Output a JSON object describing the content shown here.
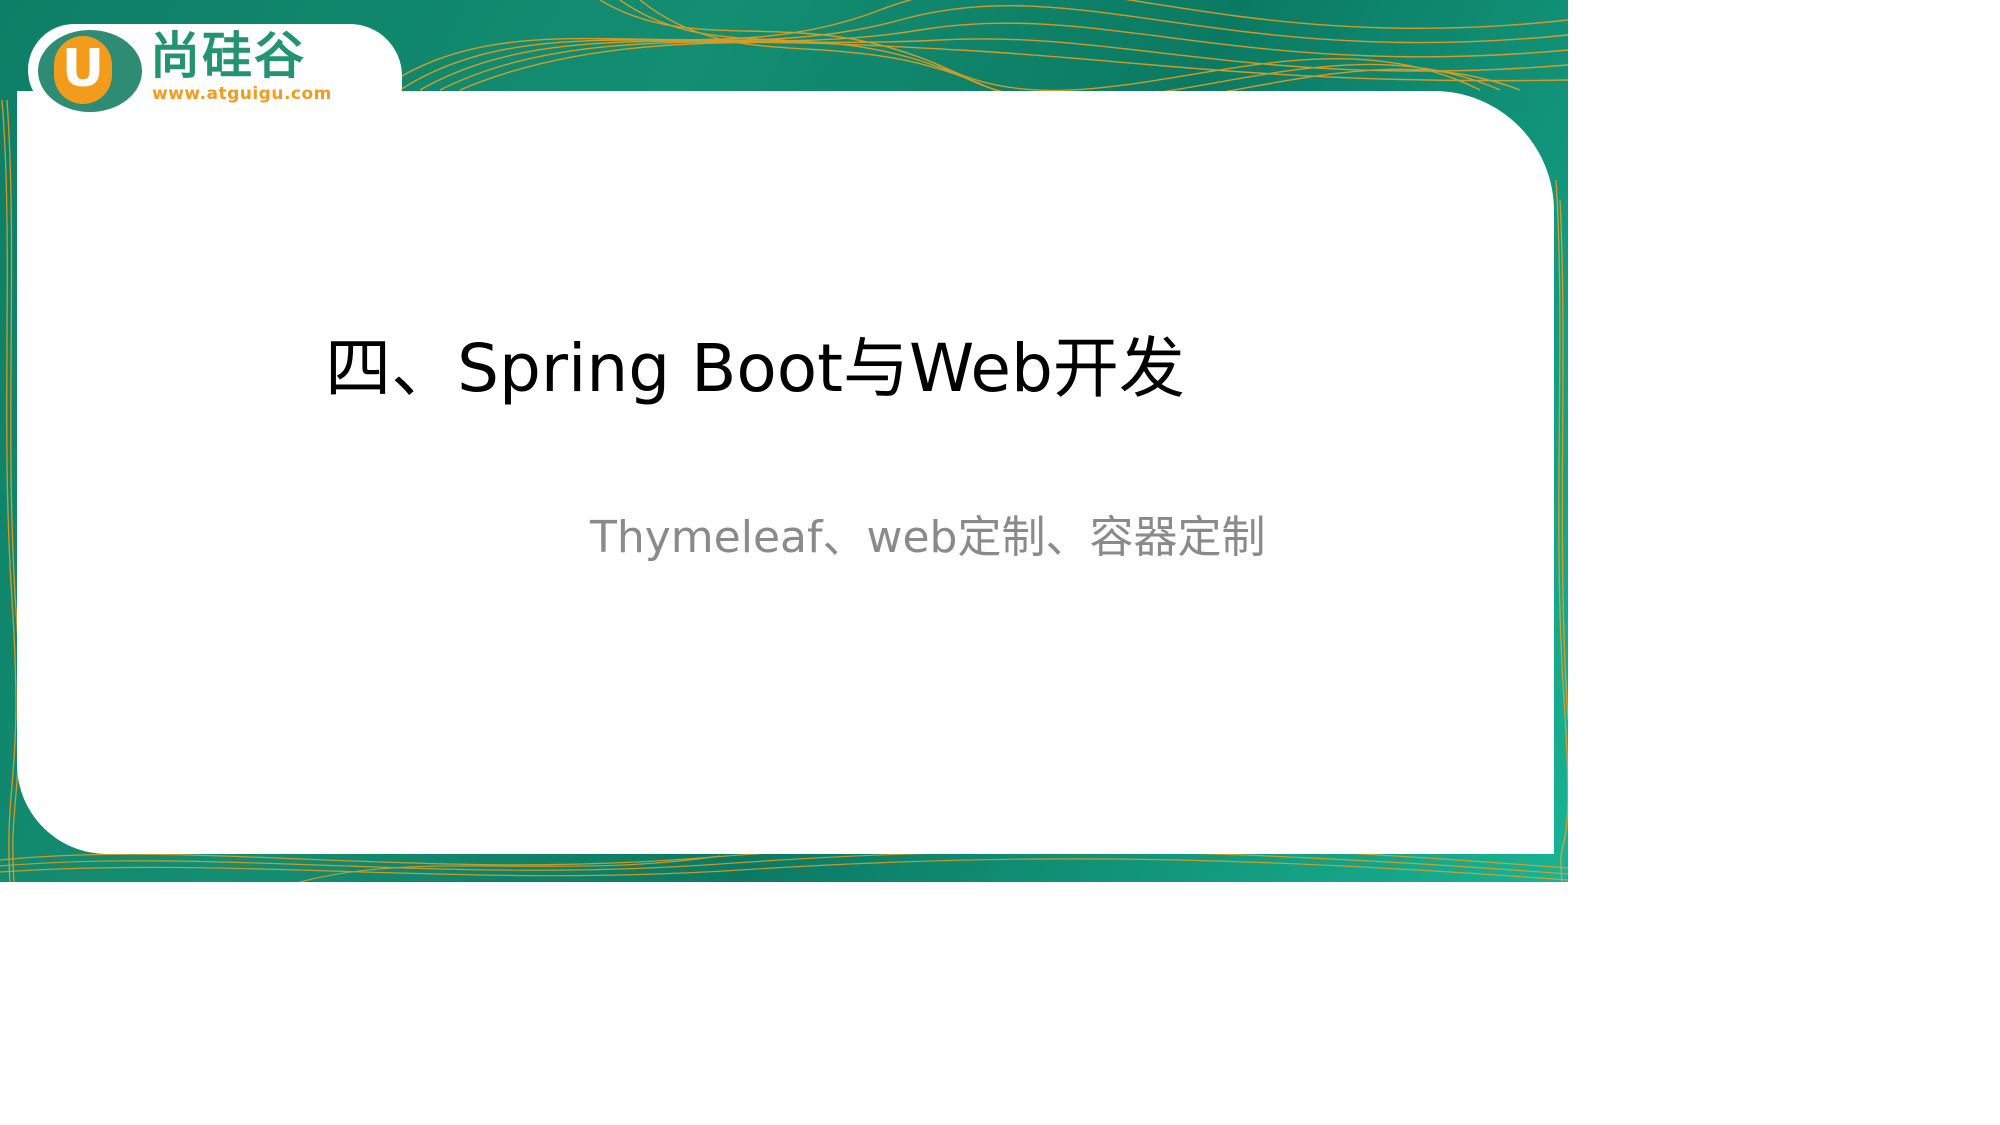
{
  "logo": {
    "badge_letter": "U",
    "name": "尚硅谷",
    "url": "www.atguigu.com"
  },
  "slide": {
    "title": "四、Spring Boot与Web开发",
    "subtitle": "Thymeleaf、web定制、容器定制"
  },
  "colors": {
    "background_green": "#0d7f66",
    "accent_orange": "#f39c1b",
    "logo_green": "#23946f",
    "title_text": "#000000",
    "subtitle_text": "#8a8a8a"
  }
}
